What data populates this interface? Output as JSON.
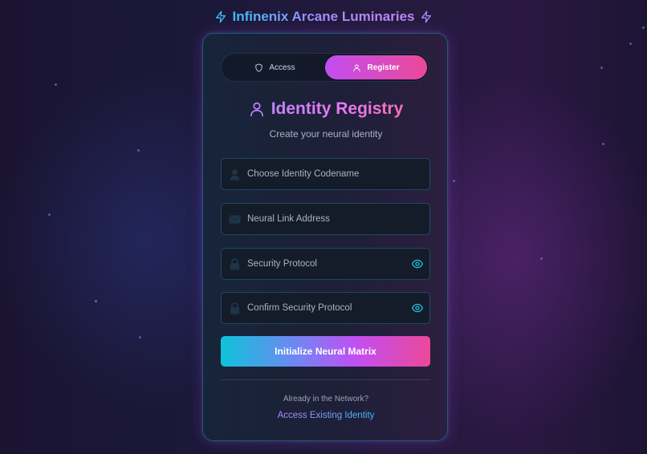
{
  "brand": {
    "title": "Infinenix Arcane Luminaries",
    "icon": "lightning-bolt-icon"
  },
  "tabs": [
    {
      "label": "Access",
      "icon": "shield-icon",
      "active": false
    },
    {
      "label": "Register",
      "icon": "user-icon",
      "active": true
    }
  ],
  "form": {
    "title": "Identity Registry",
    "title_icon": "user-icon",
    "subtitle": "Create your neural identity",
    "fields": {
      "codename": {
        "placeholder": "Choose Identity Codename",
        "value": "",
        "icon": "user-icon"
      },
      "email": {
        "placeholder": "Neural Link Address",
        "value": "",
        "icon": "mail-icon"
      },
      "password": {
        "placeholder": "Security Protocol",
        "value": "",
        "icon": "lock-icon",
        "toggle_icon": "eye-icon"
      },
      "confirm_password": {
        "placeholder": "Confirm Security Protocol",
        "value": "",
        "icon": "lock-icon",
        "toggle_icon": "eye-icon"
      }
    },
    "submit_label": "Initialize Neural Matrix"
  },
  "footer": {
    "prompt": "Already in the Network?",
    "link_label": "Access Existing Identity"
  },
  "colors": {
    "accent_cyan": "#22d3ee",
    "accent_purple": "#a855f7",
    "accent_pink": "#ec4899",
    "background": "#1b1838"
  }
}
